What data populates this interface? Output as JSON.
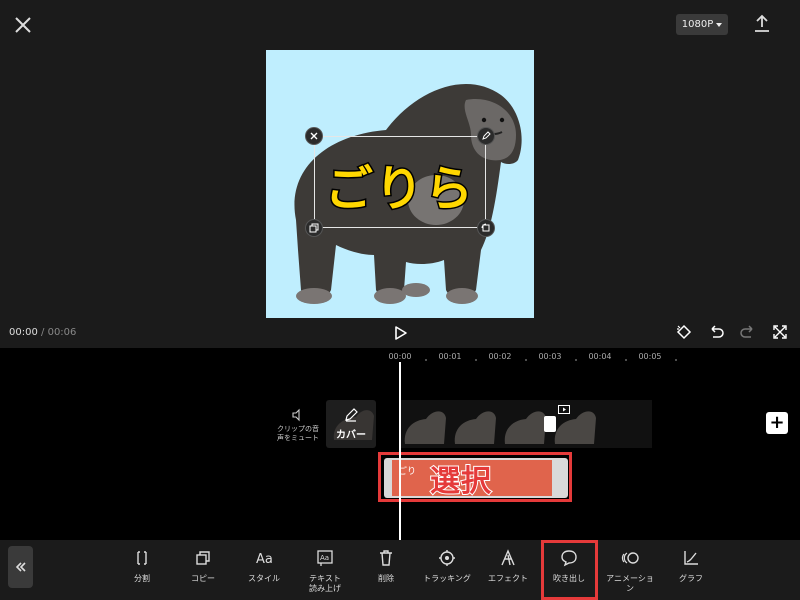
{
  "header": {
    "close_icon": "close-icon",
    "resolution": "1080P",
    "export_icon": "upload-icon"
  },
  "preview": {
    "image_description_icon": "gorilla-image",
    "text_overlay": "ごりら",
    "handles": [
      "delete-handle-icon",
      "edit-handle-icon",
      "copy-handle-icon",
      "rotate-scale-handle-icon"
    ],
    "background_color": "#bfeefe"
  },
  "playback": {
    "current_time": "00:00",
    "separator": "/",
    "total_time": "00:06",
    "play_icon": "play-icon",
    "right_tools": [
      "keyframe-icon",
      "undo-icon",
      "redo-icon",
      "fullscreen-icon"
    ]
  },
  "timeline": {
    "ruler": [
      "00:00",
      "00:01",
      "00:02",
      "00:03",
      "00:04",
      "00:05"
    ],
    "mute_label": "クリップの音\n声をミュート",
    "cover_label": "カバー",
    "text_clip_name": "ごり",
    "annotation_label": "選択",
    "add_icon": "plus-icon",
    "add_label": "+"
  },
  "toolbar": {
    "collapse_icon": "double-chevron-left-icon",
    "tools": [
      {
        "label": "分割",
        "icon": "split-icon"
      },
      {
        "label": "コピー",
        "icon": "copy-icon"
      },
      {
        "label": "スタイル",
        "icon": "text-style-icon"
      },
      {
        "label": "テキスト\n読み上げ",
        "icon": "text-to-speech-icon"
      },
      {
        "label": "削除",
        "icon": "trash-icon"
      },
      {
        "label": "トラッキング",
        "icon": "tracking-icon"
      },
      {
        "label": "エフェクト",
        "icon": "effect-icon"
      },
      {
        "label": "吹き出し",
        "icon": "speech-bubble-icon"
      },
      {
        "label": "アニメーショ\nン",
        "icon": "animation-icon"
      },
      {
        "label": "グラフ",
        "icon": "graph-icon"
      }
    ],
    "highlight_color": "#e53a3a"
  }
}
